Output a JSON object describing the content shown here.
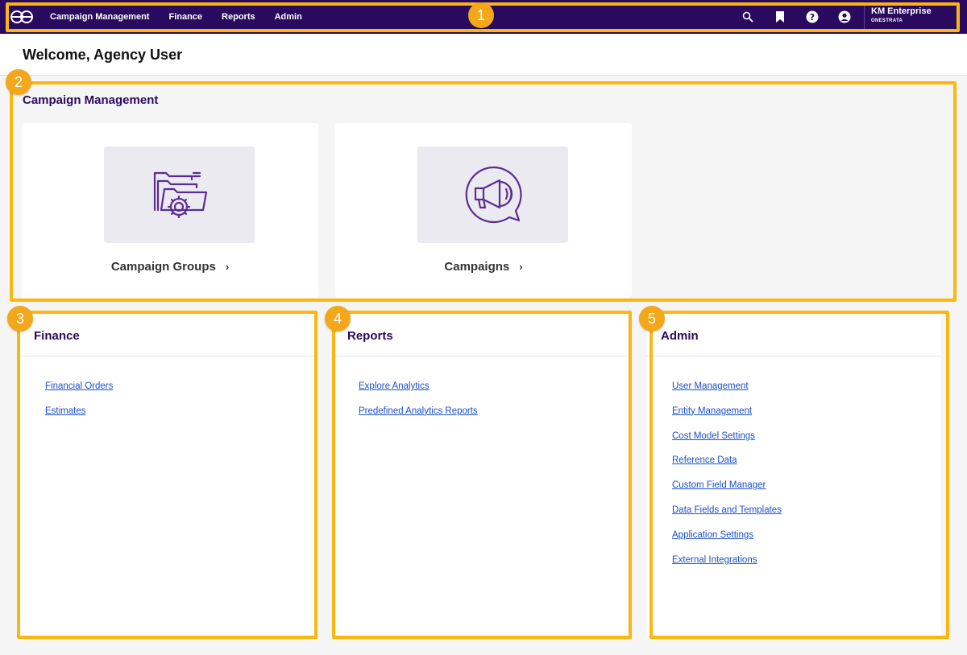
{
  "nav": {
    "logo_icon": "onestrata-logo-icon",
    "links": [
      "Campaign Management",
      "Finance",
      "Reports",
      "Admin"
    ],
    "icons": [
      "search-icon",
      "bookmark-icon",
      "help-icon",
      "user-icon"
    ],
    "account_name": "KM Enterprise",
    "account_org": "ONESTRATA"
  },
  "welcome": {
    "title": "Welcome, Agency User"
  },
  "campaign_management": {
    "title": "Campaign Management",
    "cards": [
      {
        "label": "Campaign Groups",
        "icon": "folder-gear-icon"
      },
      {
        "label": "Campaigns",
        "icon": "megaphone-icon"
      }
    ]
  },
  "finance": {
    "title": "Finance",
    "links": [
      "Financial Orders",
      "Estimates"
    ]
  },
  "reports": {
    "title": "Reports",
    "links": [
      "Explore Analytics",
      "Predefined Analytics Reports"
    ]
  },
  "admin": {
    "title": "Admin",
    "links": [
      "User Management",
      "Entity Management",
      "Cost Model Settings",
      "Reference Data",
      "Custom Field Manager",
      "Data Fields and Templates",
      "Application Settings",
      "External Integrations"
    ]
  },
  "annotations": [
    "1",
    "2",
    "3",
    "4",
    "5"
  ],
  "colors": {
    "nav_bg": "#2a0a5e",
    "highlight": "#fbb70f",
    "badge": "#f3a81c",
    "link": "#1a4fcf",
    "illustration": "#5b2d91"
  }
}
